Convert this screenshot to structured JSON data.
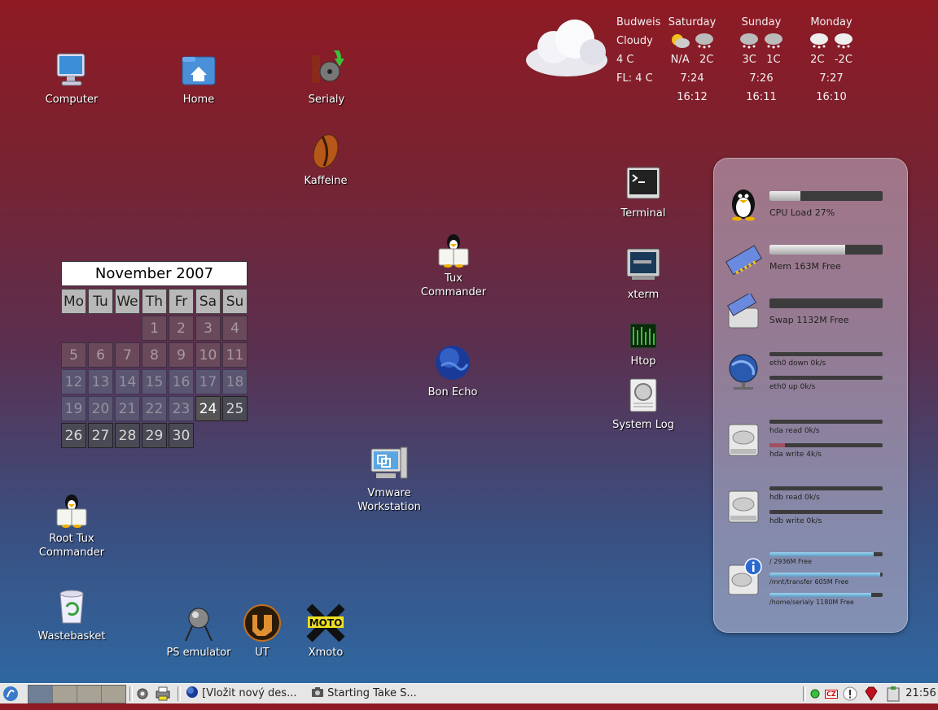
{
  "desktop": {
    "icons": {
      "computer": "Computer",
      "home": "Home",
      "serialy": "Serialy",
      "kaffeine": "Kaffeine",
      "tux_commander": "Tux Commander",
      "bon_echo": "Bon Echo",
      "vmware": "Vmware Workstation",
      "root_tux": "Root Tux Commander",
      "wastebasket": "Wastebasket",
      "ps_emulator": "PS emulator",
      "ut": "UT",
      "xmoto": "Xmoto",
      "terminal": "Terminal",
      "xterm": "xterm",
      "htop": "Htop",
      "system_log": "System Log"
    }
  },
  "weather": {
    "city": "Budweis",
    "condition": "Cloudy",
    "temp": "4 C",
    "feels_like": "FL: 4 C",
    "days": [
      {
        "name": "Saturday",
        "t1": "N/A",
        "t2": "2C",
        "sun1": "7:24",
        "sun2": "16:12"
      },
      {
        "name": "Sunday",
        "t1": "3C",
        "t2": "1C",
        "sun1": "7:26",
        "sun2": "16:11"
      },
      {
        "name": "Monday",
        "t1": "2C",
        "t2": "-2C",
        "sun1": "7:27",
        "sun2": "16:10"
      }
    ]
  },
  "calendar": {
    "title": "November 2007",
    "weekdays": [
      "Mo",
      "Tu",
      "We",
      "Th",
      "Fr",
      "Sa",
      "Su"
    ],
    "days": [
      "1",
      "2",
      "3",
      "4",
      "5",
      "6",
      "7",
      "8",
      "9",
      "10",
      "11",
      "12",
      "13",
      "14",
      "15",
      "16",
      "17",
      "18",
      "19",
      "20",
      "21",
      "22",
      "23",
      "24",
      "25",
      "26",
      "27",
      "28",
      "29",
      "30"
    ]
  },
  "sysmon": {
    "cpu": {
      "label": "CPU Load 27%",
      "level": 0.27
    },
    "mem": {
      "label": "Mem 163M Free",
      "level": 0.67
    },
    "swap": {
      "label": "Swap 1132M Free",
      "level": 0.0
    },
    "eth0_down": {
      "label": "eth0 down 0k/s",
      "level": 0.0
    },
    "eth0_up": {
      "label": "eth0 up 0k/s",
      "level": 0.0
    },
    "hda_read": {
      "label": "hda read 0k/s",
      "level": 0.0
    },
    "hda_write": {
      "label": "hda write 4k/s",
      "level": 0.14
    },
    "hdb_read": {
      "label": "hdb read 0k/s",
      "level": 0.0
    },
    "hdb_write": {
      "label": "hdb write 0k/s",
      "level": 0.0
    },
    "fs_root": {
      "label": "/ 2936M Free",
      "level": 0.92
    },
    "fs_transfer": {
      "label": "/mnt/transfer 605M Free",
      "level": 0.98
    },
    "fs_home": {
      "label": "/home/serialy 1180M Free",
      "level": 0.9
    }
  },
  "taskbar": {
    "task1": "[Vložit nový des...",
    "task2": "Starting Take S...",
    "clock": "21:56",
    "lang": "CZ"
  },
  "colors": {
    "bg_top": "#8e1a24",
    "bg_bottom": "#2e6aa5"
  }
}
